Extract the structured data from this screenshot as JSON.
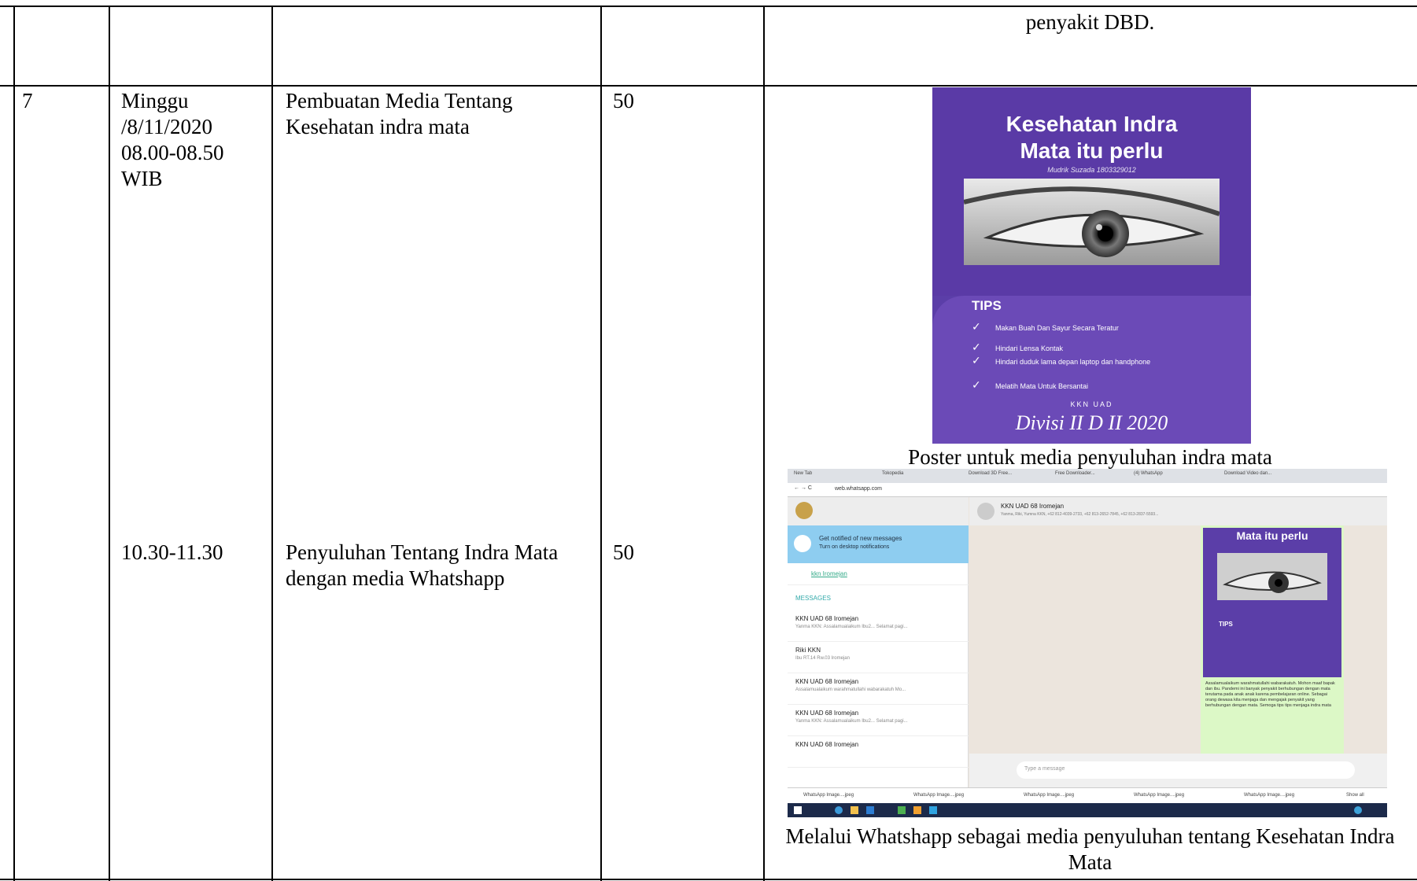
{
  "row_prev": {
    "activity_description_tail": "penyakit DBD."
  },
  "row_7": {
    "no": "7",
    "day_date": "Minggu /8/11/2020",
    "time_1": "08.00-08.50 WIB",
    "activity_1": "Pembuatan Media Tentang Kesehatan indra mata",
    "participants_1": "50",
    "time_2": "10.30-11.30",
    "activity_2": "Penyuluhan Tentang Indra Mata dengan media Whatshapp",
    "participants_2": "50",
    "caption_1": "Poster untuk media penyuluhan indra mata",
    "caption_2": "Melalui Whatshapp sebagai media penyuluhan tentang Kesehatan Indra Mata"
  },
  "poster": {
    "title_line1": "Kesehatan Indra",
    "title_line2": "Mata itu perlu",
    "author": "Mudrik Suzada 1803329012",
    "tips_heading": "TIPS",
    "tips": [
      "Makan Buah Dan Sayur Secara Teratur",
      "Hindari Lensa Kontak",
      "Hindari duduk lama depan laptop dan handphone",
      "Melatih Mata Untuk Bersantai"
    ],
    "org": "KKN UAD",
    "signature": "Divisi II D II 2020",
    "colors": {
      "background": "#5b3ea8",
      "text": "#ffffff"
    }
  },
  "whatsapp_screenshot": {
    "tabs": [
      "New Tab",
      "Tokopedia",
      "Download 3D Free...",
      "Free Downloader...",
      "(4) WhatsApp",
      "Download Video dan..."
    ],
    "url": "web.whatsapp.com",
    "notification_title": "Get notified of new messages",
    "notification_sub": "Turn on desktop notifications",
    "search_value": "kkn Iromejan",
    "messages_label": "MESSAGES",
    "chats": [
      {
        "name": "KKN UAD 68 Iromejan",
        "preview": "Yanma KKN: Assalamualaikum Ibu2... Selamat pagi..."
      },
      {
        "name": "Riki KKN",
        "preview": "Ibu RT.14 Rw.03 Iromejan"
      },
      {
        "name": "KKN UAD 68 Iromejan",
        "preview": "Assalamualaikum warahmatullahi wabarakatuh Mo..."
      },
      {
        "name": "KKN UAD 68 Iromejan",
        "preview": "Yanma KKN: Assalamualaikum Ibu2... Selamat pagi..."
      },
      {
        "name": "KKN UAD 68 Iromejan",
        "preview": ""
      }
    ],
    "group_name": "KKN UAD 68 Iromejan",
    "group_members": "Yanma, Riki, Yumna KKN, +62 812-4039-2733, +62 813-2652-7845, +62 813-2837-5593...",
    "bubble_image_title": "Mata itu perlu",
    "bubble_image_tips": "TIPS",
    "bubble_text": "Assalamualaikum warahmatullahi wabarakatuh. Mohon maaf bapak dan ibu. Pandemi ini banyak penyakit berhubungan dengan mata terutama pada anak anak karena pembelajaran online. Sebagai orang dewasa kita menjaga dan mengajak penyakit yang berhubungan dengan mata. Semoga tips tips menjaga indra mata",
    "input_placeholder": "Type a message",
    "downloads": [
      "WhatsApp Image....jpeg",
      "WhatsApp Image....jpeg",
      "WhatsApp Image....jpeg",
      "WhatsApp Image....jpeg",
      "WhatsApp Image....jpeg"
    ],
    "show_all": "Show all"
  }
}
